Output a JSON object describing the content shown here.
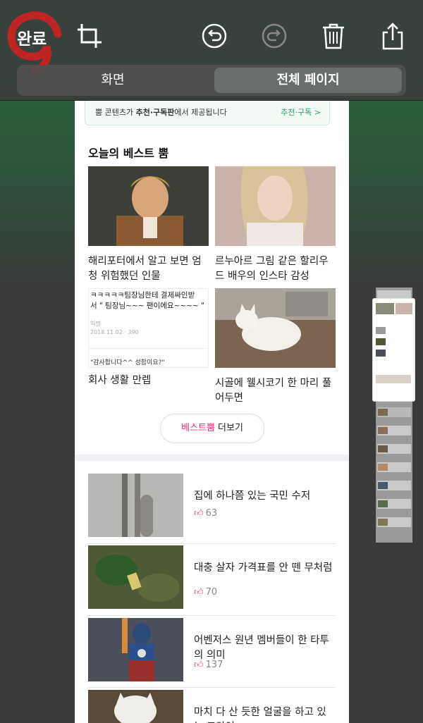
{
  "toolbar": {
    "done_label": "완료",
    "icons": [
      "crop-icon",
      "undo-icon",
      "redo-icon",
      "trash-icon",
      "share-icon"
    ],
    "segments": {
      "screen": "화면",
      "full_page": "전체 페이지",
      "selected": "full_page"
    }
  },
  "page": {
    "banner": {
      "text_prefix": "뿜 콘텐츠가 ",
      "text_bold": "추천·구독판",
      "text_suffix": "에서 제공됩니다",
      "link": "추천·구독 >"
    },
    "best": {
      "title": "오늘의 베스트 뿜",
      "items": [
        {
          "caption": "해리포터에서 알고 보면 엄청 위험했던 인물"
        },
        {
          "caption": "르누아르 그림 같은 할리우드 배우의 인스타 감성"
        },
        {
          "caption": "회사 생활 만렙",
          "thumb_text": {
            "line1": "ㅋㅋㅋㅋㅋ팀장님한테 결제싸인받",
            "line2": "서 \" 팀장님~~~ 팬이에요~~~~ \"",
            "author": "익명",
            "date": "2018.11.02",
            "views": "390",
            "quote": "\"감사합니다^^ 성함이요?\""
          }
        },
        {
          "caption": "시골에 웰시코기 한 마리 풀어두면"
        }
      ],
      "more_pink": "베스트뿜",
      "more_rest": " 더보기"
    },
    "list": [
      {
        "title": "집에 하나쯤 있는 국민 수저",
        "likes": "63"
      },
      {
        "title": "대충 살자 가격표를 안 뗀 무처럼",
        "likes": "70"
      },
      {
        "title": "어벤저스 원년 멤버들이 한 타투의 의미",
        "likes": "137"
      },
      {
        "title": "마치 다 산 듯한 얼굴을 하고 있는 고양이",
        "likes": ""
      }
    ]
  },
  "colors": {
    "accent_green": "#1fa35d",
    "accent_pink": "#e8336f",
    "scribble_red": "#d62020"
  }
}
